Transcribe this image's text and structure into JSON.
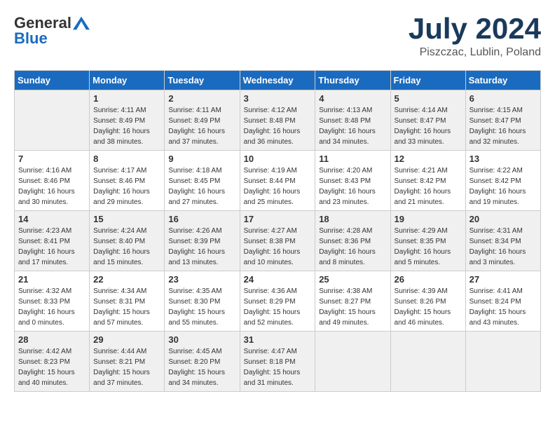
{
  "header": {
    "logo": {
      "general": "General",
      "blue": "Blue"
    },
    "title": "July 2024",
    "location": "Piszczac, Lublin, Poland"
  },
  "weekdays": [
    "Sunday",
    "Monday",
    "Tuesday",
    "Wednesday",
    "Thursday",
    "Friday",
    "Saturday"
  ],
  "weeks": [
    [
      {
        "day": "",
        "sunrise": "",
        "sunset": "",
        "daylight": ""
      },
      {
        "day": "1",
        "sunrise": "Sunrise: 4:11 AM",
        "sunset": "Sunset: 8:49 PM",
        "daylight": "Daylight: 16 hours and 38 minutes."
      },
      {
        "day": "2",
        "sunrise": "Sunrise: 4:11 AM",
        "sunset": "Sunset: 8:49 PM",
        "daylight": "Daylight: 16 hours and 37 minutes."
      },
      {
        "day": "3",
        "sunrise": "Sunrise: 4:12 AM",
        "sunset": "Sunset: 8:48 PM",
        "daylight": "Daylight: 16 hours and 36 minutes."
      },
      {
        "day": "4",
        "sunrise": "Sunrise: 4:13 AM",
        "sunset": "Sunset: 8:48 PM",
        "daylight": "Daylight: 16 hours and 34 minutes."
      },
      {
        "day": "5",
        "sunrise": "Sunrise: 4:14 AM",
        "sunset": "Sunset: 8:47 PM",
        "daylight": "Daylight: 16 hours and 33 minutes."
      },
      {
        "day": "6",
        "sunrise": "Sunrise: 4:15 AM",
        "sunset": "Sunset: 8:47 PM",
        "daylight": "Daylight: 16 hours and 32 minutes."
      }
    ],
    [
      {
        "day": "7",
        "sunrise": "Sunrise: 4:16 AM",
        "sunset": "Sunset: 8:46 PM",
        "daylight": "Daylight: 16 hours and 30 minutes."
      },
      {
        "day": "8",
        "sunrise": "Sunrise: 4:17 AM",
        "sunset": "Sunset: 8:46 PM",
        "daylight": "Daylight: 16 hours and 29 minutes."
      },
      {
        "day": "9",
        "sunrise": "Sunrise: 4:18 AM",
        "sunset": "Sunset: 8:45 PM",
        "daylight": "Daylight: 16 hours and 27 minutes."
      },
      {
        "day": "10",
        "sunrise": "Sunrise: 4:19 AM",
        "sunset": "Sunset: 8:44 PM",
        "daylight": "Daylight: 16 hours and 25 minutes."
      },
      {
        "day": "11",
        "sunrise": "Sunrise: 4:20 AM",
        "sunset": "Sunset: 8:43 PM",
        "daylight": "Daylight: 16 hours and 23 minutes."
      },
      {
        "day": "12",
        "sunrise": "Sunrise: 4:21 AM",
        "sunset": "Sunset: 8:42 PM",
        "daylight": "Daylight: 16 hours and 21 minutes."
      },
      {
        "day": "13",
        "sunrise": "Sunrise: 4:22 AM",
        "sunset": "Sunset: 8:42 PM",
        "daylight": "Daylight: 16 hours and 19 minutes."
      }
    ],
    [
      {
        "day": "14",
        "sunrise": "Sunrise: 4:23 AM",
        "sunset": "Sunset: 8:41 PM",
        "daylight": "Daylight: 16 hours and 17 minutes."
      },
      {
        "day": "15",
        "sunrise": "Sunrise: 4:24 AM",
        "sunset": "Sunset: 8:40 PM",
        "daylight": "Daylight: 16 hours and 15 minutes."
      },
      {
        "day": "16",
        "sunrise": "Sunrise: 4:26 AM",
        "sunset": "Sunset: 8:39 PM",
        "daylight": "Daylight: 16 hours and 13 minutes."
      },
      {
        "day": "17",
        "sunrise": "Sunrise: 4:27 AM",
        "sunset": "Sunset: 8:38 PM",
        "daylight": "Daylight: 16 hours and 10 minutes."
      },
      {
        "day": "18",
        "sunrise": "Sunrise: 4:28 AM",
        "sunset": "Sunset: 8:36 PM",
        "daylight": "Daylight: 16 hours and 8 minutes."
      },
      {
        "day": "19",
        "sunrise": "Sunrise: 4:29 AM",
        "sunset": "Sunset: 8:35 PM",
        "daylight": "Daylight: 16 hours and 5 minutes."
      },
      {
        "day": "20",
        "sunrise": "Sunrise: 4:31 AM",
        "sunset": "Sunset: 8:34 PM",
        "daylight": "Daylight: 16 hours and 3 minutes."
      }
    ],
    [
      {
        "day": "21",
        "sunrise": "Sunrise: 4:32 AM",
        "sunset": "Sunset: 8:33 PM",
        "daylight": "Daylight: 16 hours and 0 minutes."
      },
      {
        "day": "22",
        "sunrise": "Sunrise: 4:34 AM",
        "sunset": "Sunset: 8:31 PM",
        "daylight": "Daylight: 15 hours and 57 minutes."
      },
      {
        "day": "23",
        "sunrise": "Sunrise: 4:35 AM",
        "sunset": "Sunset: 8:30 PM",
        "daylight": "Daylight: 15 hours and 55 minutes."
      },
      {
        "day": "24",
        "sunrise": "Sunrise: 4:36 AM",
        "sunset": "Sunset: 8:29 PM",
        "daylight": "Daylight: 15 hours and 52 minutes."
      },
      {
        "day": "25",
        "sunrise": "Sunrise: 4:38 AM",
        "sunset": "Sunset: 8:27 PM",
        "daylight": "Daylight: 15 hours and 49 minutes."
      },
      {
        "day": "26",
        "sunrise": "Sunrise: 4:39 AM",
        "sunset": "Sunset: 8:26 PM",
        "daylight": "Daylight: 15 hours and 46 minutes."
      },
      {
        "day": "27",
        "sunrise": "Sunrise: 4:41 AM",
        "sunset": "Sunset: 8:24 PM",
        "daylight": "Daylight: 15 hours and 43 minutes."
      }
    ],
    [
      {
        "day": "28",
        "sunrise": "Sunrise: 4:42 AM",
        "sunset": "Sunset: 8:23 PM",
        "daylight": "Daylight: 15 hours and 40 minutes."
      },
      {
        "day": "29",
        "sunrise": "Sunrise: 4:44 AM",
        "sunset": "Sunset: 8:21 PM",
        "daylight": "Daylight: 15 hours and 37 minutes."
      },
      {
        "day": "30",
        "sunrise": "Sunrise: 4:45 AM",
        "sunset": "Sunset: 8:20 PM",
        "daylight": "Daylight: 15 hours and 34 minutes."
      },
      {
        "day": "31",
        "sunrise": "Sunrise: 4:47 AM",
        "sunset": "Sunset: 8:18 PM",
        "daylight": "Daylight: 15 hours and 31 minutes."
      },
      {
        "day": "",
        "sunrise": "",
        "sunset": "",
        "daylight": ""
      },
      {
        "day": "",
        "sunrise": "",
        "sunset": "",
        "daylight": ""
      },
      {
        "day": "",
        "sunrise": "",
        "sunset": "",
        "daylight": ""
      }
    ]
  ]
}
